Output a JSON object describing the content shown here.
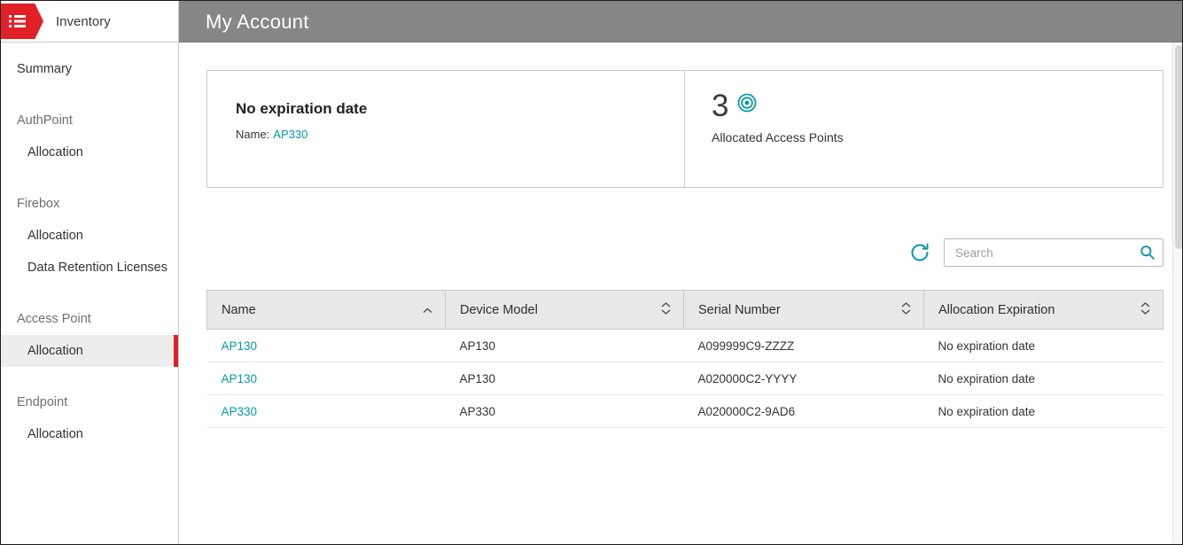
{
  "window": {
    "title": "My Account"
  },
  "sidebar": {
    "brand_label": "Inventory",
    "items": [
      {
        "label": "Summary"
      },
      {
        "label": "AuthPoint"
      },
      {
        "label": "Allocation"
      },
      {
        "label": "Firebox"
      },
      {
        "label": "Allocation"
      },
      {
        "label": "Data Retention Licenses"
      },
      {
        "label": "Access Point"
      },
      {
        "label": "Allocation",
        "selected": true
      },
      {
        "label": "Endpoint"
      },
      {
        "label": "Allocation"
      }
    ]
  },
  "cards": {
    "expiration": {
      "title": "No expiration date",
      "name_label": "Name:",
      "name_value": "AP330"
    },
    "allocated": {
      "count": "3",
      "label": "Allocated Access Points"
    }
  },
  "toolbar": {
    "search_placeholder": "Search"
  },
  "table": {
    "columns": [
      {
        "label": "Name",
        "sort": "asc"
      },
      {
        "label": "Device Model",
        "sort": "none"
      },
      {
        "label": "Serial Number",
        "sort": "none"
      },
      {
        "label": "Allocation Expiration",
        "sort": "none"
      }
    ],
    "rows": [
      {
        "name": "AP130",
        "model": "AP130",
        "serial": "A099999C9-ZZZZ",
        "expiration": "No expiration date"
      },
      {
        "name": "AP130",
        "model": "AP130",
        "serial": "A020000C2-YYYY",
        "expiration": "No expiration date"
      },
      {
        "name": "AP330",
        "model": "AP330",
        "serial": "A020000C2-9AD6",
        "expiration": "No expiration date"
      }
    ]
  },
  "colors": {
    "accent_teal": "#0099a8",
    "brand_red": "#e01f26",
    "header_gray": "#868686"
  }
}
